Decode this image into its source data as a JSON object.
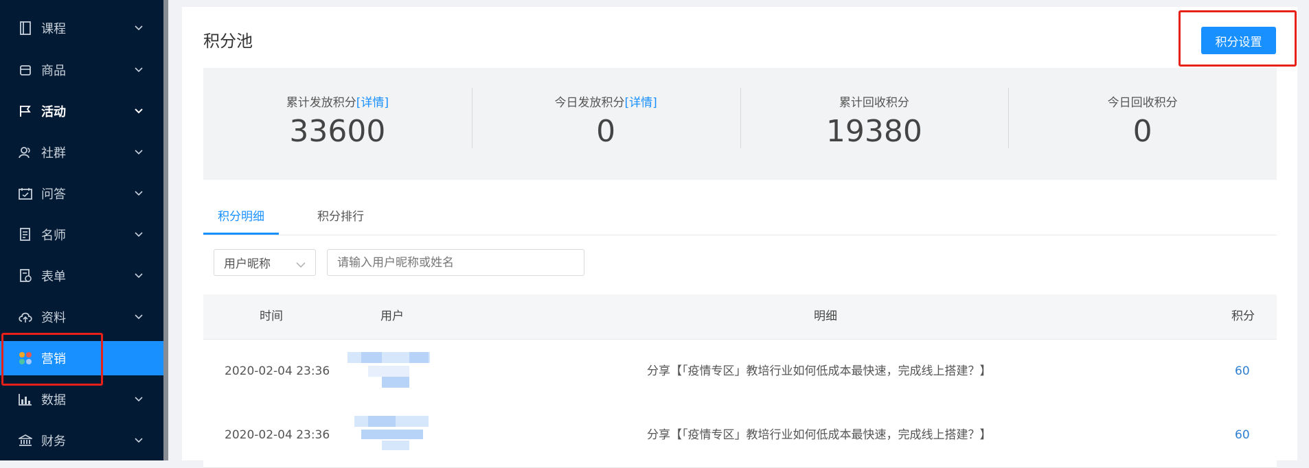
{
  "sidebar": {
    "items": [
      {
        "label": "课程",
        "icon": "book-icon"
      },
      {
        "label": "商品",
        "icon": "box-icon"
      },
      {
        "label": "活动",
        "icon": "flag-icon"
      },
      {
        "label": "社群",
        "icon": "users-icon"
      },
      {
        "label": "问答",
        "icon": "qa-icon"
      },
      {
        "label": "名师",
        "icon": "teacher-icon"
      },
      {
        "label": "表单",
        "icon": "form-icon"
      },
      {
        "label": "资料",
        "icon": "cloud-upload-icon"
      },
      {
        "label": "营销",
        "icon": "marketing-icon"
      },
      {
        "label": "数据",
        "icon": "chart-icon"
      },
      {
        "label": "财务",
        "icon": "bank-icon"
      }
    ],
    "active_label": "营销",
    "expanded_label": "活动"
  },
  "header": {
    "title": "积分池",
    "settings_button": "积分设置"
  },
  "stats": [
    {
      "label": "累计发放积分",
      "link": "[详情]",
      "value": "33600"
    },
    {
      "label": "今日发放积分",
      "link": "[详情]",
      "value": "0"
    },
    {
      "label": "累计回收积分",
      "value": "19380"
    },
    {
      "label": "今日回收积分",
      "value": "0"
    }
  ],
  "tabs": [
    {
      "label": "积分明细",
      "active": true
    },
    {
      "label": "积分排行",
      "active": false
    }
  ],
  "filter": {
    "select_value": "用户昵称",
    "search_placeholder": "请输入用户昵称或姓名"
  },
  "table": {
    "headers": [
      "时间",
      "用户",
      "明细",
      "积分"
    ],
    "rows": [
      {
        "time": "2020-02-04 23:36",
        "detail": "分享【「疫情专区」教培行业如何低成本最快速，完成线上搭建？】",
        "points": "60"
      },
      {
        "time": "2020-02-04 23:36",
        "detail": "分享【「疫情专区」教培行业如何低成本最快速，完成线上搭建？】",
        "points": "60"
      }
    ]
  },
  "colors": {
    "sidebar_bg": "#021a33",
    "accent": "#1890ff",
    "highlight_box": "#e8201a"
  }
}
